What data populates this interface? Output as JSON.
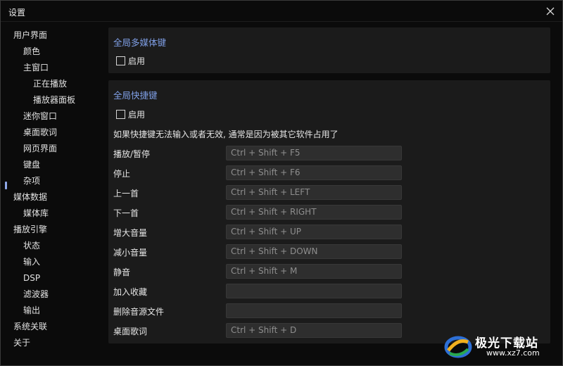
{
  "window": {
    "title": "设置"
  },
  "sidebar": {
    "items": [
      {
        "label": "用户界面",
        "level": 0
      },
      {
        "label": "颜色",
        "level": 1
      },
      {
        "label": "主窗口",
        "level": 1
      },
      {
        "label": "正在播放",
        "level": 2
      },
      {
        "label": "播放器面板",
        "level": 2
      },
      {
        "label": "迷你窗口",
        "level": 1
      },
      {
        "label": "桌面歌词",
        "level": 1
      },
      {
        "label": "网页界面",
        "level": 1
      },
      {
        "label": "键盘",
        "level": 1,
        "selected": true
      },
      {
        "label": "杂项",
        "level": 1
      },
      {
        "label": "媒体数据",
        "level": 0
      },
      {
        "label": "媒体库",
        "level": 1
      },
      {
        "label": "播放引擎",
        "level": 0
      },
      {
        "label": "状态",
        "level": 1
      },
      {
        "label": "输入",
        "level": 1
      },
      {
        "label": "DSP",
        "level": 1
      },
      {
        "label": "滤波器",
        "level": 1
      },
      {
        "label": "输出",
        "level": 1
      },
      {
        "label": "系统关联",
        "level": 0
      },
      {
        "label": "关于",
        "level": 0
      }
    ]
  },
  "media_keys": {
    "title": "全局多媒体键",
    "enable_label": "启用",
    "enabled": false
  },
  "hotkeys": {
    "title": "全局快捷键",
    "enable_label": "启用",
    "enabled": false,
    "hint": "如果快捷键无法输入或者无效, 通常是因为被其它软件占用了",
    "rows": [
      {
        "label": "播放/暂停",
        "value": "Ctrl + Shift + F5"
      },
      {
        "label": "停止",
        "value": "Ctrl + Shift + F6"
      },
      {
        "label": "上一首",
        "value": "Ctrl + Shift + LEFT"
      },
      {
        "label": "下一首",
        "value": "Ctrl + Shift + RIGHT"
      },
      {
        "label": "增大音量",
        "value": "Ctrl + Shift + UP"
      },
      {
        "label": "减小音量",
        "value": "Ctrl + Shift + DOWN"
      },
      {
        "label": "静音",
        "value": "Ctrl + Shift + M"
      },
      {
        "label": "加入收藏",
        "value": ""
      },
      {
        "label": "删除音源文件",
        "value": ""
      },
      {
        "label": "桌面歌词",
        "value": "Ctrl + Shift + D"
      }
    ]
  },
  "watermark": {
    "text": "极光下载站",
    "url": "www.xz7.com"
  },
  "colors": {
    "accent": "#7f9fe6",
    "panel": "#1b1b1b",
    "background": "#0b0b0b",
    "input": "#2e2e2e"
  }
}
